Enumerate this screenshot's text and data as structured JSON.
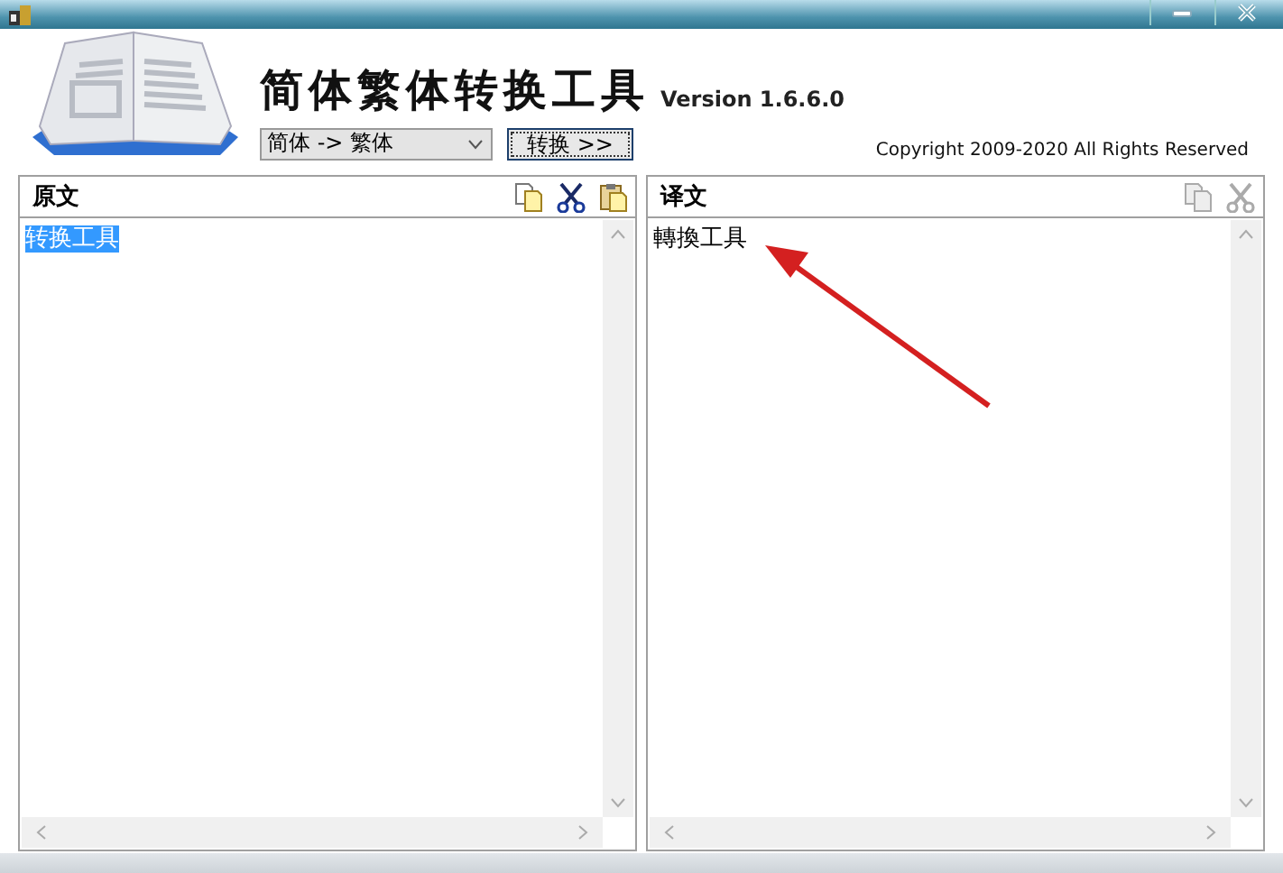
{
  "app": {
    "title": "简体繁体转换工具",
    "version": "Version 1.6.6.0",
    "direction": {
      "value": "简体 -> 繁体"
    },
    "convert_button": "转换 >>",
    "copyright": "Copyright 2009-2020 All Rights Reserved"
  },
  "panels": [
    {
      "title": "原文",
      "text": "转换工具",
      "text_selected": true,
      "tools": [
        {
          "kind": "copy",
          "disabled": false
        },
        {
          "kind": "cut",
          "disabled": false
        },
        {
          "kind": "paste",
          "disabled": false
        }
      ]
    },
    {
      "title": "译文",
      "text": "轉換工具",
      "text_selected": false,
      "tools": [
        {
          "kind": "copy",
          "disabled": true
        },
        {
          "kind": "cut",
          "disabled": true
        }
      ]
    }
  ]
}
